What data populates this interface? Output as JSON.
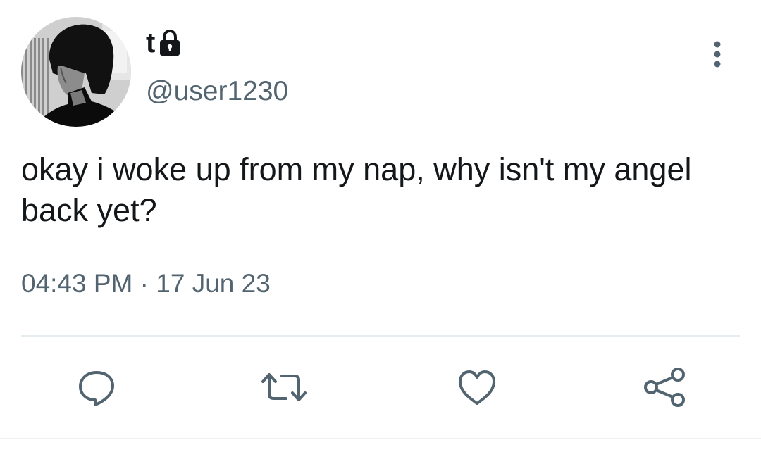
{
  "tweet": {
    "author": {
      "display_name": "t",
      "handle": "@user1230",
      "protected_icon": "lock-icon",
      "avatar": "avatar-photo"
    },
    "more_icon": "more-vertical-icon",
    "text": "okay i woke up from my nap, why isn't my angel back yet?",
    "time": "04:43 PM",
    "separator": "·",
    "date": "17 Jun 23",
    "actions": [
      {
        "name": "reply",
        "icon": "reply-icon"
      },
      {
        "name": "retweet",
        "icon": "retweet-icon"
      },
      {
        "name": "like",
        "icon": "heart-icon"
      },
      {
        "name": "share",
        "icon": "share-icon"
      }
    ]
  },
  "colors": {
    "text_primary": "#14171a",
    "text_secondary": "#536471",
    "icon": "#536471",
    "divider": "#e6ecf0",
    "background": "#ffffff"
  }
}
